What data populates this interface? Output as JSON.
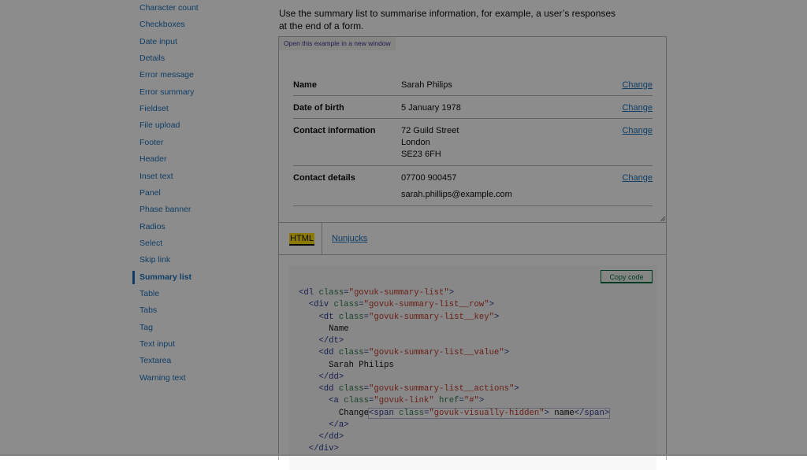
{
  "sidebar": {
    "items": [
      {
        "label": "Character count",
        "active": false
      },
      {
        "label": "Checkboxes",
        "active": false
      },
      {
        "label": "Date input",
        "active": false
      },
      {
        "label": "Details",
        "active": false
      },
      {
        "label": "Error message",
        "active": false
      },
      {
        "label": "Error summary",
        "active": false
      },
      {
        "label": "Fieldset",
        "active": false
      },
      {
        "label": "File upload",
        "active": false
      },
      {
        "label": "Footer",
        "active": false
      },
      {
        "label": "Header",
        "active": false
      },
      {
        "label": "Inset text",
        "active": false
      },
      {
        "label": "Panel",
        "active": false
      },
      {
        "label": "Phase banner",
        "active": false
      },
      {
        "label": "Radios",
        "active": false
      },
      {
        "label": "Select",
        "active": false
      },
      {
        "label": "Skip link",
        "active": false
      },
      {
        "label": "Summary list",
        "active": true
      },
      {
        "label": "Table",
        "active": false
      },
      {
        "label": "Tabs",
        "active": false
      },
      {
        "label": "Tag",
        "active": false
      },
      {
        "label": "Text input",
        "active": false
      },
      {
        "label": "Textarea",
        "active": false
      },
      {
        "label": "Warning text",
        "active": false
      }
    ]
  },
  "main": {
    "intro": "Use the summary list to summarise information, for example, a user’s responses at the end of a form.",
    "example": {
      "open_link": "Open this example in a new window",
      "rows": [
        {
          "key": "Name",
          "values": [
            "Sarah Philips"
          ],
          "action": "Change"
        },
        {
          "key": "Date of birth",
          "values": [
            "5 January 1978"
          ],
          "action": "Change"
        },
        {
          "key": "Contact information",
          "values": [
            "72 Guild Street",
            "London",
            "SE23 6FH"
          ],
          "action": "Change"
        },
        {
          "key": "Contact details",
          "values": [
            "07700 900457",
            "sarah.phillips@example.com"
          ],
          "action": "Change"
        }
      ]
    },
    "tabs": [
      {
        "label": "HTML",
        "selected": true
      },
      {
        "label": "Nunjucks",
        "selected": false
      }
    ],
    "code": {
      "copy_label": "Copy code",
      "lines": [
        "<dl class=\"govuk-summary-list\">",
        "  <div class=\"govuk-summary-list__row\">",
        "    <dt class=\"govuk-summary-list__key\">",
        "      Name",
        "    </dt>",
        "    <dd class=\"govuk-summary-list__value\">",
        "      Sarah Philips",
        "    </dd>",
        "    <dd class=\"govuk-summary-list__actions\">",
        "      <a class=\"govuk-link\" href=\"#\">",
        "        Change<span class=\"govuk-visually-hidden\"> name</span>",
        "      </a>",
        "    </dd>",
        "  </div>"
      ],
      "highlighted_text": "<span class=\"govuk-visually-hidden\"> name</span>"
    }
  },
  "colors": {
    "link": "#1d70b8",
    "visited_link": "#4c2c92",
    "focus_yellow": "#ffdd00",
    "button_green": "#00703c",
    "overlay": "rgba(0,0,0,0.45)"
  }
}
